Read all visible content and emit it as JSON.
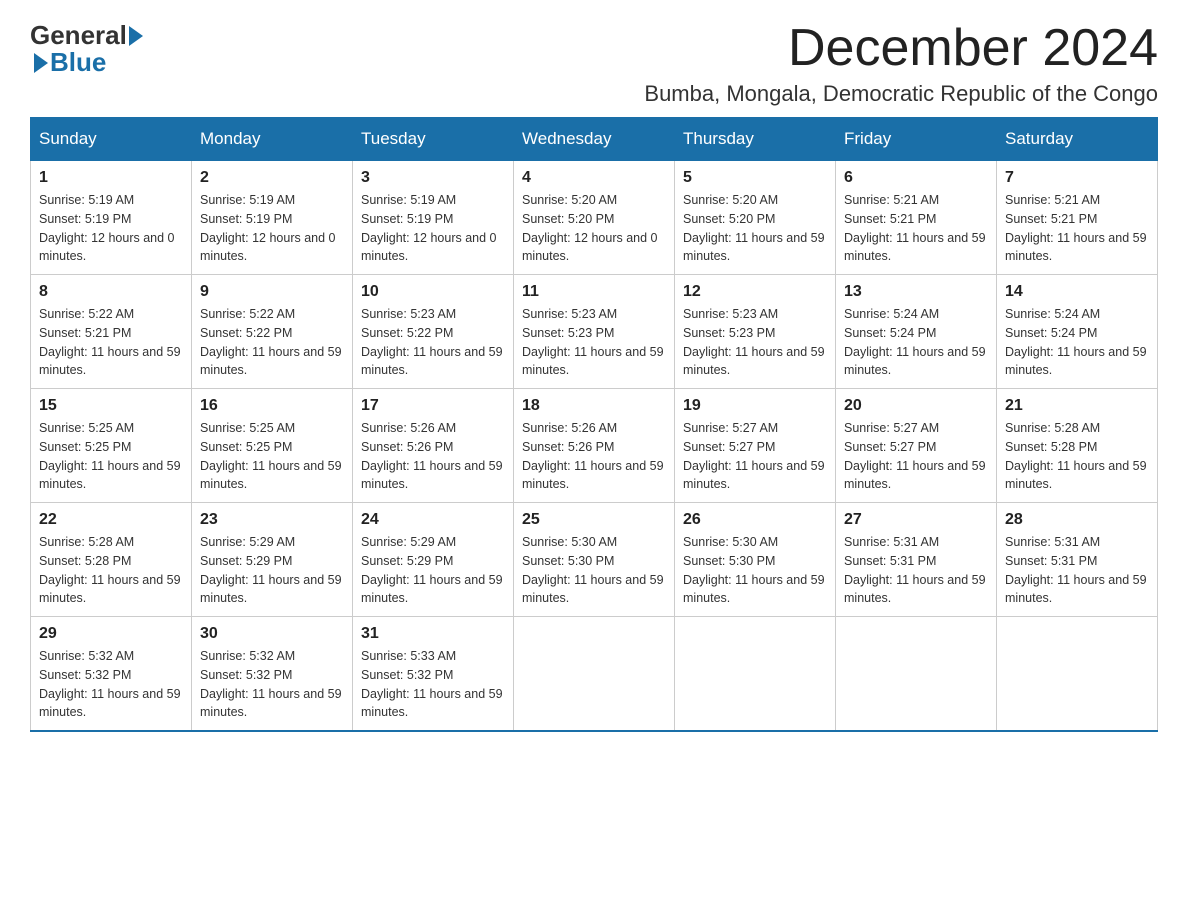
{
  "logo": {
    "general": "General",
    "blue": "Blue"
  },
  "title": {
    "month_year": "December 2024",
    "location": "Bumba, Mongala, Democratic Republic of the Congo"
  },
  "weekdays": [
    "Sunday",
    "Monday",
    "Tuesday",
    "Wednesday",
    "Thursday",
    "Friday",
    "Saturday"
  ],
  "weeks": [
    [
      {
        "day": "1",
        "sunrise": "5:19 AM",
        "sunset": "5:19 PM",
        "daylight": "12 hours and 0 minutes."
      },
      {
        "day": "2",
        "sunrise": "5:19 AM",
        "sunset": "5:19 PM",
        "daylight": "12 hours and 0 minutes."
      },
      {
        "day": "3",
        "sunrise": "5:19 AM",
        "sunset": "5:19 PM",
        "daylight": "12 hours and 0 minutes."
      },
      {
        "day": "4",
        "sunrise": "5:20 AM",
        "sunset": "5:20 PM",
        "daylight": "12 hours and 0 minutes."
      },
      {
        "day": "5",
        "sunrise": "5:20 AM",
        "sunset": "5:20 PM",
        "daylight": "11 hours and 59 minutes."
      },
      {
        "day": "6",
        "sunrise": "5:21 AM",
        "sunset": "5:21 PM",
        "daylight": "11 hours and 59 minutes."
      },
      {
        "day": "7",
        "sunrise": "5:21 AM",
        "sunset": "5:21 PM",
        "daylight": "11 hours and 59 minutes."
      }
    ],
    [
      {
        "day": "8",
        "sunrise": "5:22 AM",
        "sunset": "5:21 PM",
        "daylight": "11 hours and 59 minutes."
      },
      {
        "day": "9",
        "sunrise": "5:22 AM",
        "sunset": "5:22 PM",
        "daylight": "11 hours and 59 minutes."
      },
      {
        "day": "10",
        "sunrise": "5:23 AM",
        "sunset": "5:22 PM",
        "daylight": "11 hours and 59 minutes."
      },
      {
        "day": "11",
        "sunrise": "5:23 AM",
        "sunset": "5:23 PM",
        "daylight": "11 hours and 59 minutes."
      },
      {
        "day": "12",
        "sunrise": "5:23 AM",
        "sunset": "5:23 PM",
        "daylight": "11 hours and 59 minutes."
      },
      {
        "day": "13",
        "sunrise": "5:24 AM",
        "sunset": "5:24 PM",
        "daylight": "11 hours and 59 minutes."
      },
      {
        "day": "14",
        "sunrise": "5:24 AM",
        "sunset": "5:24 PM",
        "daylight": "11 hours and 59 minutes."
      }
    ],
    [
      {
        "day": "15",
        "sunrise": "5:25 AM",
        "sunset": "5:25 PM",
        "daylight": "11 hours and 59 minutes."
      },
      {
        "day": "16",
        "sunrise": "5:25 AM",
        "sunset": "5:25 PM",
        "daylight": "11 hours and 59 minutes."
      },
      {
        "day": "17",
        "sunrise": "5:26 AM",
        "sunset": "5:26 PM",
        "daylight": "11 hours and 59 minutes."
      },
      {
        "day": "18",
        "sunrise": "5:26 AM",
        "sunset": "5:26 PM",
        "daylight": "11 hours and 59 minutes."
      },
      {
        "day": "19",
        "sunrise": "5:27 AM",
        "sunset": "5:27 PM",
        "daylight": "11 hours and 59 minutes."
      },
      {
        "day": "20",
        "sunrise": "5:27 AM",
        "sunset": "5:27 PM",
        "daylight": "11 hours and 59 minutes."
      },
      {
        "day": "21",
        "sunrise": "5:28 AM",
        "sunset": "5:28 PM",
        "daylight": "11 hours and 59 minutes."
      }
    ],
    [
      {
        "day": "22",
        "sunrise": "5:28 AM",
        "sunset": "5:28 PM",
        "daylight": "11 hours and 59 minutes."
      },
      {
        "day": "23",
        "sunrise": "5:29 AM",
        "sunset": "5:29 PM",
        "daylight": "11 hours and 59 minutes."
      },
      {
        "day": "24",
        "sunrise": "5:29 AM",
        "sunset": "5:29 PM",
        "daylight": "11 hours and 59 minutes."
      },
      {
        "day": "25",
        "sunrise": "5:30 AM",
        "sunset": "5:30 PM",
        "daylight": "11 hours and 59 minutes."
      },
      {
        "day": "26",
        "sunrise": "5:30 AM",
        "sunset": "5:30 PM",
        "daylight": "11 hours and 59 minutes."
      },
      {
        "day": "27",
        "sunrise": "5:31 AM",
        "sunset": "5:31 PM",
        "daylight": "11 hours and 59 minutes."
      },
      {
        "day": "28",
        "sunrise": "5:31 AM",
        "sunset": "5:31 PM",
        "daylight": "11 hours and 59 minutes."
      }
    ],
    [
      {
        "day": "29",
        "sunrise": "5:32 AM",
        "sunset": "5:32 PM",
        "daylight": "11 hours and 59 minutes."
      },
      {
        "day": "30",
        "sunrise": "5:32 AM",
        "sunset": "5:32 PM",
        "daylight": "11 hours and 59 minutes."
      },
      {
        "day": "31",
        "sunrise": "5:33 AM",
        "sunset": "5:32 PM",
        "daylight": "11 hours and 59 minutes."
      },
      null,
      null,
      null,
      null
    ]
  ]
}
